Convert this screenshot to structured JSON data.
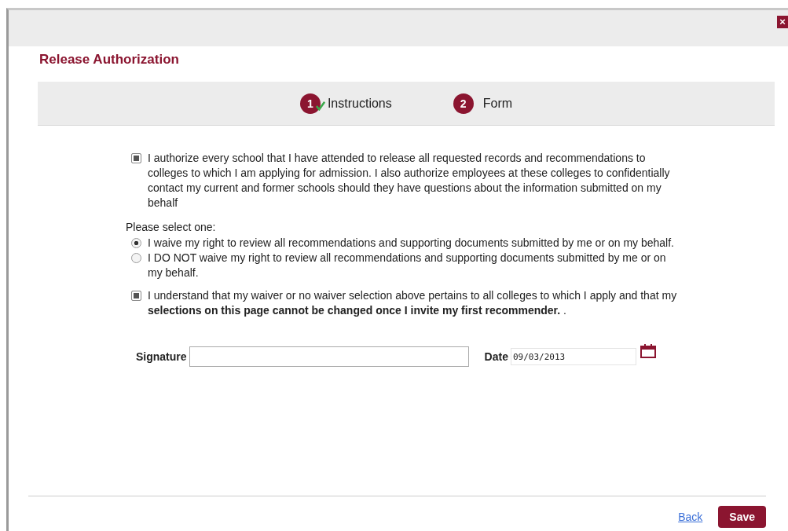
{
  "dialog": {
    "close": "×",
    "title": "Release Authorization"
  },
  "steps": [
    {
      "number": "1",
      "label": "Instructions",
      "completed": true
    },
    {
      "number": "2",
      "label": "Form",
      "completed": false
    }
  ],
  "items": [
    {
      "kind": "checkbox",
      "checked": true,
      "text": "I authorize every school that I have attended to release all requested records and recommendations to colleges to which I am applying for admission. I also authorize employees at these colleges to confidentially contact my current and former schools should they have questions about the information submitted on my behalf"
    },
    {
      "kind": "prompt",
      "text": "Please select one:"
    },
    {
      "kind": "radio",
      "selected": true,
      "text": "I waive my right to review all recommendations and supporting documents submitted by me or on my behalf."
    },
    {
      "kind": "radio",
      "selected": false,
      "text": "I DO NOT waive my right to review all recommendations and supporting documents submitted by me or on my behalf."
    },
    {
      "kind": "checkbox",
      "checked": true,
      "text": "I understand that my waiver or no waiver selection above pertains to all colleges to which I apply and that my **selections on this page cannot be changed once I invite my first recommender.** ."
    }
  ],
  "signature": {
    "label": "Signature"
  },
  "date": {
    "label": "Date",
    "value": "09/03/2013"
  },
  "footer": {
    "back": "Back",
    "save": "Save"
  }
}
